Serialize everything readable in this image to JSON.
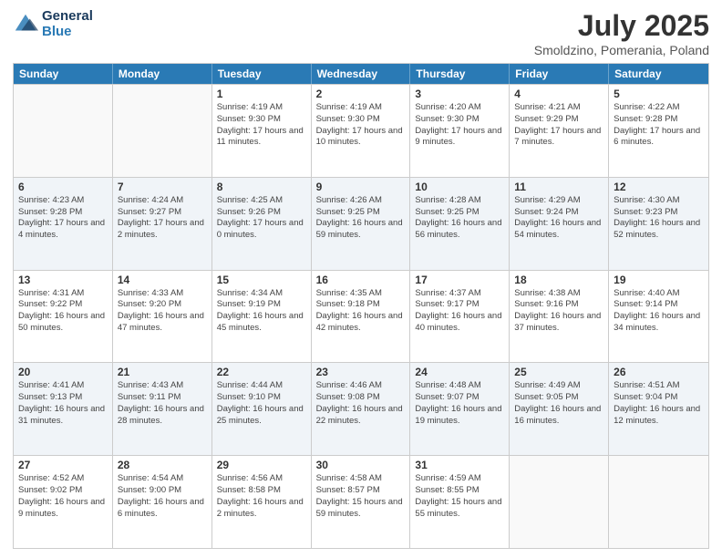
{
  "logo": {
    "line1": "General",
    "line2": "Blue"
  },
  "title": "July 2025",
  "subtitle": "Smoldzino, Pomerania, Poland",
  "weekdays": [
    "Sunday",
    "Monday",
    "Tuesday",
    "Wednesday",
    "Thursday",
    "Friday",
    "Saturday"
  ],
  "rows": [
    [
      {
        "day": "",
        "info": ""
      },
      {
        "day": "",
        "info": ""
      },
      {
        "day": "1",
        "info": "Sunrise: 4:19 AM\nSunset: 9:30 PM\nDaylight: 17 hours and 11 minutes."
      },
      {
        "day": "2",
        "info": "Sunrise: 4:19 AM\nSunset: 9:30 PM\nDaylight: 17 hours and 10 minutes."
      },
      {
        "day": "3",
        "info": "Sunrise: 4:20 AM\nSunset: 9:30 PM\nDaylight: 17 hours and 9 minutes."
      },
      {
        "day": "4",
        "info": "Sunrise: 4:21 AM\nSunset: 9:29 PM\nDaylight: 17 hours and 7 minutes."
      },
      {
        "day": "5",
        "info": "Sunrise: 4:22 AM\nSunset: 9:28 PM\nDaylight: 17 hours and 6 minutes."
      }
    ],
    [
      {
        "day": "6",
        "info": "Sunrise: 4:23 AM\nSunset: 9:28 PM\nDaylight: 17 hours and 4 minutes."
      },
      {
        "day": "7",
        "info": "Sunrise: 4:24 AM\nSunset: 9:27 PM\nDaylight: 17 hours and 2 minutes."
      },
      {
        "day": "8",
        "info": "Sunrise: 4:25 AM\nSunset: 9:26 PM\nDaylight: 17 hours and 0 minutes."
      },
      {
        "day": "9",
        "info": "Sunrise: 4:26 AM\nSunset: 9:25 PM\nDaylight: 16 hours and 59 minutes."
      },
      {
        "day": "10",
        "info": "Sunrise: 4:28 AM\nSunset: 9:25 PM\nDaylight: 16 hours and 56 minutes."
      },
      {
        "day": "11",
        "info": "Sunrise: 4:29 AM\nSunset: 9:24 PM\nDaylight: 16 hours and 54 minutes."
      },
      {
        "day": "12",
        "info": "Sunrise: 4:30 AM\nSunset: 9:23 PM\nDaylight: 16 hours and 52 minutes."
      }
    ],
    [
      {
        "day": "13",
        "info": "Sunrise: 4:31 AM\nSunset: 9:22 PM\nDaylight: 16 hours and 50 minutes."
      },
      {
        "day": "14",
        "info": "Sunrise: 4:33 AM\nSunset: 9:20 PM\nDaylight: 16 hours and 47 minutes."
      },
      {
        "day": "15",
        "info": "Sunrise: 4:34 AM\nSunset: 9:19 PM\nDaylight: 16 hours and 45 minutes."
      },
      {
        "day": "16",
        "info": "Sunrise: 4:35 AM\nSunset: 9:18 PM\nDaylight: 16 hours and 42 minutes."
      },
      {
        "day": "17",
        "info": "Sunrise: 4:37 AM\nSunset: 9:17 PM\nDaylight: 16 hours and 40 minutes."
      },
      {
        "day": "18",
        "info": "Sunrise: 4:38 AM\nSunset: 9:16 PM\nDaylight: 16 hours and 37 minutes."
      },
      {
        "day": "19",
        "info": "Sunrise: 4:40 AM\nSunset: 9:14 PM\nDaylight: 16 hours and 34 minutes."
      }
    ],
    [
      {
        "day": "20",
        "info": "Sunrise: 4:41 AM\nSunset: 9:13 PM\nDaylight: 16 hours and 31 minutes."
      },
      {
        "day": "21",
        "info": "Sunrise: 4:43 AM\nSunset: 9:11 PM\nDaylight: 16 hours and 28 minutes."
      },
      {
        "day": "22",
        "info": "Sunrise: 4:44 AM\nSunset: 9:10 PM\nDaylight: 16 hours and 25 minutes."
      },
      {
        "day": "23",
        "info": "Sunrise: 4:46 AM\nSunset: 9:08 PM\nDaylight: 16 hours and 22 minutes."
      },
      {
        "day": "24",
        "info": "Sunrise: 4:48 AM\nSunset: 9:07 PM\nDaylight: 16 hours and 19 minutes."
      },
      {
        "day": "25",
        "info": "Sunrise: 4:49 AM\nSunset: 9:05 PM\nDaylight: 16 hours and 16 minutes."
      },
      {
        "day": "26",
        "info": "Sunrise: 4:51 AM\nSunset: 9:04 PM\nDaylight: 16 hours and 12 minutes."
      }
    ],
    [
      {
        "day": "27",
        "info": "Sunrise: 4:52 AM\nSunset: 9:02 PM\nDaylight: 16 hours and 9 minutes."
      },
      {
        "day": "28",
        "info": "Sunrise: 4:54 AM\nSunset: 9:00 PM\nDaylight: 16 hours and 6 minutes."
      },
      {
        "day": "29",
        "info": "Sunrise: 4:56 AM\nSunset: 8:58 PM\nDaylight: 16 hours and 2 minutes."
      },
      {
        "day": "30",
        "info": "Sunrise: 4:58 AM\nSunset: 8:57 PM\nDaylight: 15 hours and 59 minutes."
      },
      {
        "day": "31",
        "info": "Sunrise: 4:59 AM\nSunset: 8:55 PM\nDaylight: 15 hours and 55 minutes."
      },
      {
        "day": "",
        "info": ""
      },
      {
        "day": "",
        "info": ""
      }
    ]
  ]
}
